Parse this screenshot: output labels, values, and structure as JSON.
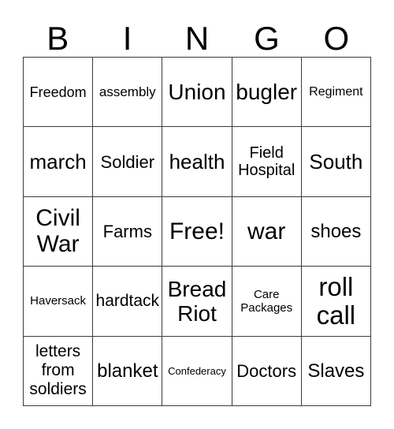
{
  "card": {
    "background_color": "#ffffff",
    "text_color": "#000000",
    "border_color": "#3b3b3b",
    "header": {
      "letters": [
        {
          "label": "B"
        },
        {
          "label": "I"
        },
        {
          "label": "N"
        },
        {
          "label": "G"
        },
        {
          "label": "O"
        }
      ]
    },
    "grid": {
      "columns": 5,
      "rows": 5,
      "free_space_index": 12,
      "cells": [
        {
          "text": "Freedom",
          "size": "fs-18",
          "column": "B",
          "row": 1
        },
        {
          "text": "assembly",
          "size": "fs-17",
          "column": "I",
          "row": 1
        },
        {
          "text": "Union",
          "size": "fs-28",
          "column": "N",
          "row": 1
        },
        {
          "text": "bugler",
          "size": "fs-28",
          "column": "G",
          "row": 1
        },
        {
          "text": "Regiment",
          "size": "fs-16",
          "column": "O",
          "row": 1
        },
        {
          "text": "march",
          "size": "fs-26",
          "column": "B",
          "row": 2
        },
        {
          "text": "Soldier",
          "size": "fs-22",
          "column": "I",
          "row": 2
        },
        {
          "text": "health",
          "size": "fs-26",
          "column": "N",
          "row": 2
        },
        {
          "text": "Field\nHospital",
          "size": "fs-20",
          "column": "G",
          "row": 2
        },
        {
          "text": "South",
          "size": "fs-26",
          "column": "O",
          "row": 2
        },
        {
          "text": "Civil\nWar",
          "size": "fs-30",
          "column": "B",
          "row": 3
        },
        {
          "text": "Farms",
          "size": "fs-22",
          "column": "I",
          "row": 3
        },
        {
          "text": "Free!",
          "size": "fs-30",
          "column": "N",
          "row": 3
        },
        {
          "text": "war",
          "size": "fs-30",
          "column": "G",
          "row": 3
        },
        {
          "text": "shoes",
          "size": "fs-24",
          "column": "O",
          "row": 3
        },
        {
          "text": "Haversack",
          "size": "fs-15",
          "column": "B",
          "row": 4
        },
        {
          "text": "hardtack",
          "size": "fs-21",
          "column": "I",
          "row": 4
        },
        {
          "text": "Bread\nRiot",
          "size": "fs-28",
          "column": "N",
          "row": 4
        },
        {
          "text": "Care\nPackages",
          "size": "fs-15",
          "column": "G",
          "row": 4
        },
        {
          "text": "roll\ncall",
          "size": "fs-33",
          "column": "O",
          "row": 4
        },
        {
          "text": "letters\nfrom\nsoldiers",
          "size": "fs-21",
          "column": "B",
          "row": 5
        },
        {
          "text": "blanket",
          "size": "fs-24",
          "column": "I",
          "row": 5
        },
        {
          "text": "Confederacy",
          "size": "fs-13",
          "column": "N",
          "row": 5
        },
        {
          "text": "Doctors",
          "size": "fs-22",
          "column": "G",
          "row": 5
        },
        {
          "text": "Slaves",
          "size": "fs-24",
          "column": "O",
          "row": 5
        }
      ]
    }
  }
}
